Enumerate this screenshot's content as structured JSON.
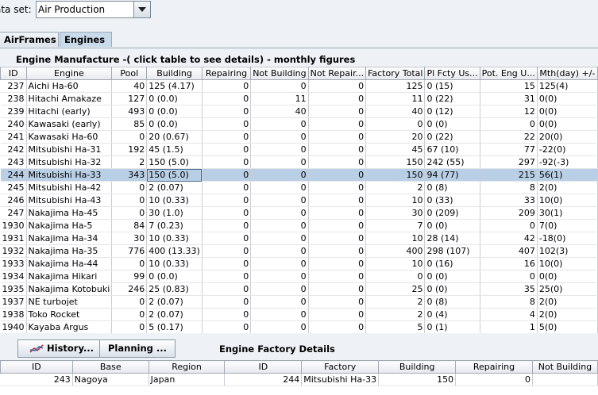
{
  "dataset": {
    "label": "ata set:",
    "value": "Air Production"
  },
  "tabs": [
    {
      "label": "AirFrames"
    },
    {
      "label": "Engines"
    }
  ],
  "table_title": "Engine Manufacture -( click table to see details) - monthly figures",
  "columns": [
    "ID",
    "Engine",
    "Pool",
    "Building",
    "Repairing",
    "Not Building",
    "Not Repair...",
    "Factory Total",
    "Pl Fcty Us...",
    "Pot. Eng U...",
    "Mth(day) +/-"
  ],
  "rows": [
    [
      "237",
      "Aichi Ha-60",
      "40",
      "125 (4.17)",
      "0",
      "0",
      "0",
      "125",
      "0 (15)",
      "15",
      "125(4)"
    ],
    [
      "238",
      "Hitachi Amakaze",
      "127",
      "0 (0.0)",
      "0",
      "11",
      "0",
      "11",
      "0 (22)",
      "31",
      "0(0)"
    ],
    [
      "239",
      "Hitachi (early)",
      "493",
      "0 (0.0)",
      "0",
      "40",
      "0",
      "40",
      "0 (12)",
      "12",
      "0(0)"
    ],
    [
      "240",
      "Kawasaki (early)",
      "85",
      "0 (0.0)",
      "0",
      "0",
      "0",
      "0",
      "0 (0)",
      "0",
      "0(0)"
    ],
    [
      "241",
      "Kawasaki Ha-60",
      "0",
      "20 (0.67)",
      "0",
      "0",
      "0",
      "20",
      "0 (22)",
      "22",
      "20(0)"
    ],
    [
      "242",
      "Mitsubishi Ha-31",
      "192",
      "45 (1.5)",
      "0",
      "0",
      "0",
      "45",
      "67 (10)",
      "77",
      "-22(0)"
    ],
    [
      "243",
      "Mitsubishi Ha-32",
      "2",
      "150 (5.0)",
      "0",
      "0",
      "0",
      "150",
      "242 (55)",
      "297",
      "-92(-3)"
    ],
    [
      "244",
      "Mitsubishi Ha-33",
      "343",
      "150 (5.0)",
      "0",
      "0",
      "0",
      "150",
      "94 (77)",
      "215",
      "56(1)"
    ],
    [
      "245",
      "Mitsubishi Ha-42",
      "0",
      "2 (0.07)",
      "0",
      "0",
      "0",
      "2",
      "0 (8)",
      "8",
      "2(0)"
    ],
    [
      "246",
      "Mitsubishi Ha-43",
      "0",
      "10 (0.33)",
      "0",
      "0",
      "0",
      "10",
      "0 (33)",
      "33",
      "10(0)"
    ],
    [
      "247",
      "Nakajima Ha-45",
      "0",
      "30 (1.0)",
      "0",
      "0",
      "0",
      "30",
      "0 (209)",
      "209",
      "30(1)"
    ],
    [
      "1930",
      "Nakajima Ha-5",
      "84",
      "7 (0.23)",
      "0",
      "0",
      "0",
      "7",
      "0 (0)",
      "0",
      "7(0)"
    ],
    [
      "1931",
      "Nakajima Ha-34",
      "30",
      "10 (0.33)",
      "0",
      "0",
      "0",
      "10",
      "28 (14)",
      "42",
      "-18(0)"
    ],
    [
      "1932",
      "Nakajima Ha-35",
      "776",
      "400 (13.33)",
      "0",
      "0",
      "0",
      "400",
      "298 (107)",
      "407",
      "102(3)"
    ],
    [
      "1933",
      "Nakajima Ha-44",
      "0",
      "10 (0.33)",
      "0",
      "0",
      "0",
      "10",
      "0 (16)",
      "16",
      "10(0)"
    ],
    [
      "1934",
      "Nakajima Hikari",
      "99",
      "0 (0.0)",
      "0",
      "0",
      "0",
      "0",
      "0 (0)",
      "0",
      "0(0)"
    ],
    [
      "1935",
      "Nakajima Kotobuki",
      "246",
      "25 (0.83)",
      "0",
      "0",
      "0",
      "25",
      "0 (0)",
      "35",
      "25(0)"
    ],
    [
      "1937",
      "NE turbojet",
      "0",
      "2 (0.07)",
      "0",
      "0",
      "0",
      "2",
      "0 (8)",
      "8",
      "2(0)"
    ],
    [
      "1938",
      "Toko Rocket",
      "0",
      "2 (0.07)",
      "0",
      "0",
      "0",
      "2",
      "0 (4)",
      "4",
      "2(0)"
    ],
    [
      "1940",
      "Kayaba Argus",
      "0",
      "5 (0.17)",
      "0",
      "0",
      "0",
      "5",
      "0 (1)",
      "1",
      "5(0)"
    ]
  ],
  "selected_row_id": "244",
  "buttons": {
    "history": "History...",
    "planning": "Planning ..."
  },
  "details_title": "Engine Factory Details",
  "details_columns": [
    "ID",
    "Base",
    "Region",
    "ID",
    "Factory",
    "Building",
    "Repairing",
    "Not Building"
  ],
  "details_row": [
    "243",
    "Nagoya",
    "Japan",
    "244",
    "Mitsubishi Ha-33",
    "150",
    "0",
    ""
  ]
}
